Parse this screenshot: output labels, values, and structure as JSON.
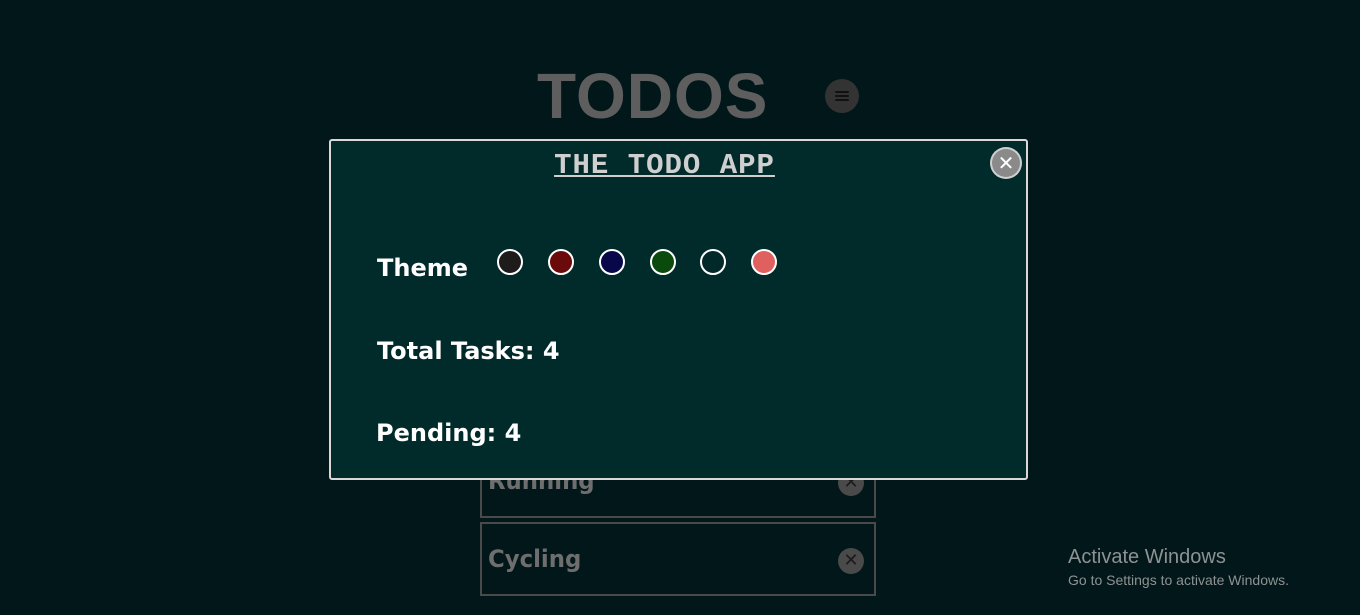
{
  "app": {
    "title": "TODOS",
    "menu_icon": "hamburger-icon"
  },
  "todos": [
    {
      "text": "Running"
    },
    {
      "text": "Cycling"
    }
  ],
  "modal": {
    "title": "THE TODO APP",
    "close_icon": "close-icon",
    "theme_label": "Theme",
    "theme_colors": [
      "#1e1b1b",
      "#6b0a0a",
      "#07074a",
      "#0a4a0d",
      "#01292a",
      "#e06060"
    ],
    "total_tasks_text": "Total Tasks: 4",
    "pending_text": "Pending: 4"
  },
  "colors": {
    "background": "#011719",
    "modal_background": "#012a2a",
    "modal_border": "#d8d8d8"
  },
  "watermark": {
    "title": "Activate Windows",
    "subtitle": "Go to Settings to activate Windows."
  }
}
